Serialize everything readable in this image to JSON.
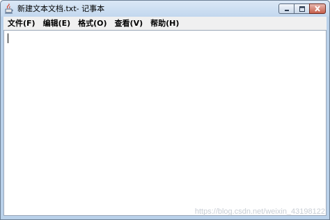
{
  "window": {
    "title": "新建文本文档.txt- 记事本"
  },
  "caption_buttons": {
    "minimize_icon": "minimize-icon",
    "maximize_icon": "maximize-icon",
    "close_icon": "close-icon"
  },
  "menu": {
    "items": [
      {
        "label": "文件(F)"
      },
      {
        "label": "编辑(E)"
      },
      {
        "label": "格式(O)"
      },
      {
        "label": "查看(V)"
      },
      {
        "label": "帮助(H)"
      }
    ]
  },
  "editor": {
    "content": ""
  },
  "watermark": {
    "text": "https://blog.csdn.net/weixin_43198122"
  },
  "colors": {
    "frame": "#b9d1ea",
    "menubar": "#f0f0f0",
    "close_button": "#c65f4b"
  }
}
